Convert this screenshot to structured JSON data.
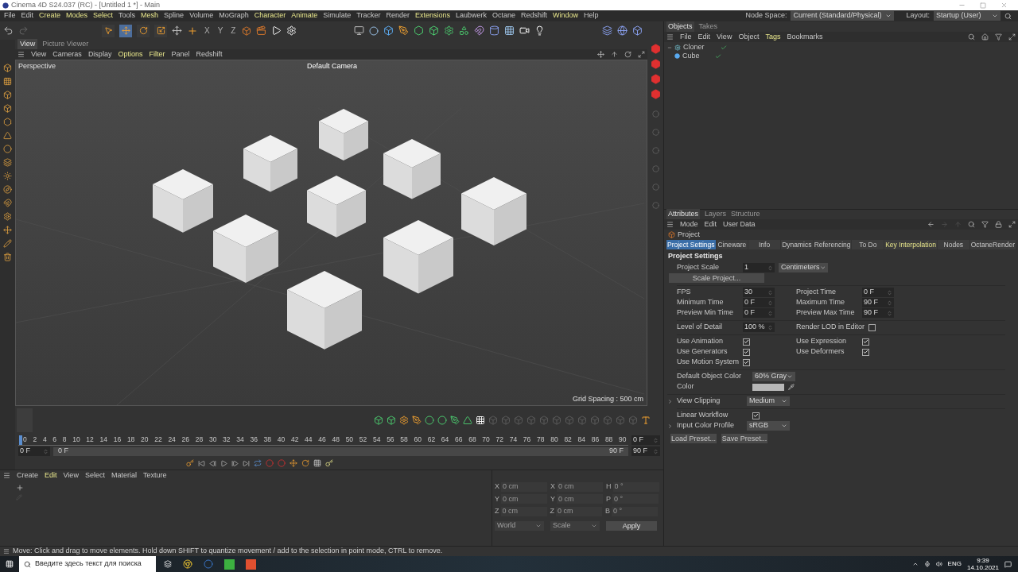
{
  "window": {
    "title": "Cinema 4D S24.037 (RC) - [Untitled 1 *] - Main"
  },
  "menu": [
    {
      "label": "File",
      "highlighted": false
    },
    {
      "label": "Edit",
      "highlighted": false
    },
    {
      "label": "Create",
      "highlighted": true
    },
    {
      "label": "Modes",
      "highlighted": true
    },
    {
      "label": "Select",
      "highlighted": true
    },
    {
      "label": "Tools",
      "highlighted": false
    },
    {
      "label": "Mesh",
      "highlighted": true
    },
    {
      "label": "Spline",
      "highlighted": false
    },
    {
      "label": "Volume",
      "highlighted": false
    },
    {
      "label": "MoGraph",
      "highlighted": false
    },
    {
      "label": "Character",
      "highlighted": true
    },
    {
      "label": "Animate",
      "highlighted": true
    },
    {
      "label": "Simulate",
      "highlighted": false
    },
    {
      "label": "Tracker",
      "highlighted": false
    },
    {
      "label": "Render",
      "highlighted": false
    },
    {
      "label": "Extensions",
      "highlighted": true
    },
    {
      "label": "Laubwerk",
      "highlighted": false
    },
    {
      "label": "Octane",
      "highlighted": false
    },
    {
      "label": "Redshift",
      "highlighted": false
    },
    {
      "label": "Window",
      "highlighted": true
    },
    {
      "label": "Help",
      "highlighted": false
    }
  ],
  "node_space": {
    "label": "Node Space:",
    "value": "Current (Standard/Physical)"
  },
  "layout": {
    "label": "Layout:",
    "value": "Startup (User)"
  },
  "toolbar": {
    "tools": [
      {
        "kind": "select",
        "selected": false
      },
      {
        "kind": "move",
        "selected": true
      },
      {
        "kind": "rotate",
        "selected": false
      },
      {
        "kind": "scale",
        "selected": false
      }
    ],
    "axes": [
      "X",
      "Y",
      "Z"
    ]
  },
  "viewport": {
    "tabs": [
      {
        "label": "View",
        "selected": true
      },
      {
        "label": "Picture Viewer",
        "selected": false
      }
    ],
    "menu": [
      {
        "label": "View",
        "highlighted": false
      },
      {
        "label": "Cameras",
        "highlighted": false
      },
      {
        "label": "Display",
        "highlighted": false
      },
      {
        "label": "Options",
        "highlighted": true
      },
      {
        "label": "Filter",
        "highlighted": true
      },
      {
        "label": "Panel",
        "highlighted": false
      },
      {
        "label": "Redshift",
        "highlighted": false
      }
    ],
    "projection": "Perspective",
    "camera": "Default Camera",
    "grid_spacing": "Grid Spacing : 500 cm"
  },
  "timeline": {
    "ruler": [
      "0",
      "2",
      "4",
      "6",
      "8",
      "10",
      "12",
      "14",
      "16",
      "18",
      "20",
      "22",
      "24",
      "26",
      "28",
      "30",
      "32",
      "34",
      "36",
      "38",
      "40",
      "42",
      "44",
      "46",
      "48",
      "50",
      "52",
      "54",
      "56",
      "58",
      "60",
      "62",
      "64",
      "66",
      "68",
      "70",
      "72",
      "74",
      "76",
      "78",
      "80",
      "82",
      "84",
      "86",
      "88",
      "90"
    ],
    "current_field": "0 F",
    "start_field": "0 F",
    "range_start": "0 F",
    "range_end": "90 F",
    "end_field": "90 F"
  },
  "materials": {
    "menu": [
      {
        "label": "Create",
        "highlighted": false
      },
      {
        "label": "Edit",
        "highlighted": true
      },
      {
        "label": "View",
        "highlighted": false
      },
      {
        "label": "Select",
        "highlighted": false
      },
      {
        "label": "Material",
        "highlighted": false
      },
      {
        "label": "Texture",
        "highlighted": false
      }
    ]
  },
  "coordinates": {
    "rows": [
      {
        "cells": [
          {
            "axis": "X",
            "placeholder": "0 cm"
          },
          {
            "axis": "X",
            "placeholder": "0 cm"
          },
          {
            "axis": "H",
            "placeholder": "0 °"
          }
        ]
      },
      {
        "cells": [
          {
            "axis": "Y",
            "placeholder": "0 cm"
          },
          {
            "axis": "Y",
            "placeholder": "0 cm"
          },
          {
            "axis": "P",
            "placeholder": "0 °"
          }
        ]
      },
      {
        "cells": [
          {
            "axis": "Z",
            "placeholder": "0 cm"
          },
          {
            "axis": "Z",
            "placeholder": "0 cm"
          },
          {
            "axis": "B",
            "placeholder": "0 °"
          }
        ]
      }
    ],
    "space": "World",
    "mode": "Scale",
    "apply": "Apply"
  },
  "status_bar": "Move: Click and drag to move elements. Hold down SHIFT to quantize movement / add to the selection in point mode, CTRL to remove.",
  "objects": {
    "tabs": [
      {
        "label": "Objects",
        "selected": true
      },
      {
        "label": "Takes",
        "selected": false
      }
    ],
    "menu": [
      {
        "label": "File",
        "highlighted": false
      },
      {
        "label": "Edit",
        "highlighted": false
      },
      {
        "label": "View",
        "highlighted": false
      },
      {
        "label": "Object",
        "highlighted": false
      },
      {
        "label": "Tags",
        "highlighted": true
      },
      {
        "label": "Bookmarks",
        "highlighted": false
      }
    ],
    "tree": [
      {
        "name": "Cloner",
        "expanded": true,
        "children": [
          {
            "name": "Cube"
          }
        ]
      }
    ]
  },
  "attributes": {
    "tabs": [
      {
        "label": "Attributes",
        "selected": true
      },
      {
        "label": "Layers",
        "selected": false
      },
      {
        "label": "Structure",
        "selected": false
      }
    ],
    "menu": [
      "Mode",
      "Edit",
      "User Data"
    ],
    "object": "Project",
    "sections": [
      {
        "label": "Project Settings",
        "selected": true,
        "highlighted": false
      },
      {
        "label": "Cineware",
        "selected": false,
        "highlighted": false
      },
      {
        "label": "Info",
        "selected": false,
        "highlighted": false
      },
      {
        "label": "Dynamics",
        "selected": false,
        "highlighted": false
      },
      {
        "label": "Referencing",
        "selected": false,
        "highlighted": false
      },
      {
        "label": "To Do",
        "selected": false,
        "highlighted": false
      },
      {
        "label": "Key Interpolation",
        "selected": false,
        "highlighted": true
      },
      {
        "label": "Nodes",
        "selected": false,
        "highlighted": false
      },
      {
        "label": "OctaneRender",
        "selected": false,
        "highlighted": false
      }
    ],
    "heading": "Project Settings",
    "project_scale": {
      "label": "Project Scale",
      "value": "1",
      "unit": "Centimeters"
    },
    "scale_button": "Scale Project...",
    "time_fields": [
      {
        "label": "FPS",
        "value": "30"
      },
      {
        "label": "Project Time",
        "value": "0 F"
      },
      {
        "label": "Minimum Time",
        "value": "0 F"
      },
      {
        "label": "Maximum Time",
        "value": "90 F"
      },
      {
        "label": "Preview Min Time",
        "value": "0 F"
      },
      {
        "label": "Preview Max Time",
        "value": "90 F"
      }
    ],
    "level_of_detail": {
      "label": "Level of Detail",
      "value": "100 %"
    },
    "render_lod": {
      "label": "Render LOD in Editor",
      "checked": false
    },
    "options": [
      {
        "label": "Use Animation",
        "checked": true
      },
      {
        "label": "Use Expression",
        "checked": true
      },
      {
        "label": "Use Generators",
        "checked": true
      },
      {
        "label": "Use Deformers",
        "checked": true
      },
      {
        "label": "Use Motion System",
        "checked": true
      }
    ],
    "default_color": {
      "label": "Default Object Color",
      "value": "60% Gray"
    },
    "color": {
      "label": "Color"
    },
    "view_clipping": {
      "label": "View Clipping",
      "value": "Medium",
      "expanded": false
    },
    "linear_workflow": {
      "label": "Linear Workflow",
      "checked": true
    },
    "input_color_profile": {
      "label": "Input Color Profile",
      "value": "sRGB",
      "expanded": false
    },
    "presets": [
      "Load Preset...",
      "Save Preset..."
    ]
  },
  "taskbar": {
    "search_placeholder": "Введите здесь текст для поиска",
    "language": "ENG",
    "time": "9:39",
    "date": "14.10.2021"
  }
}
